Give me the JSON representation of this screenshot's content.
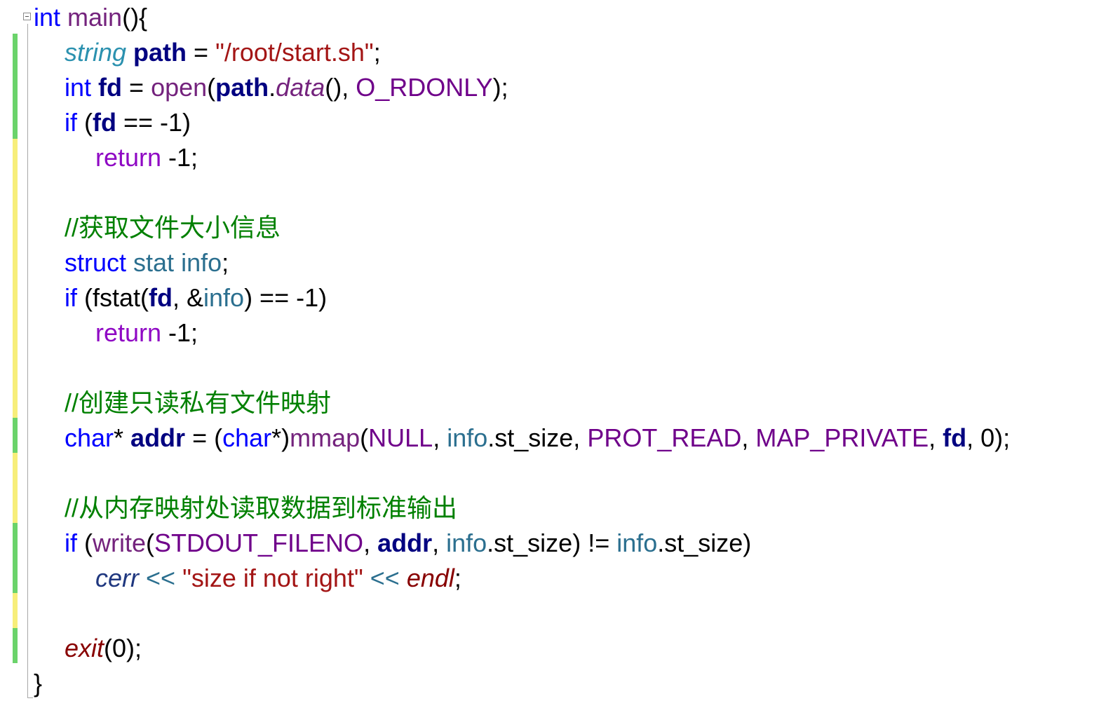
{
  "editor": {
    "colors": {
      "keyword": "#0000ff",
      "type": "#2b91af",
      "variable": "#000080",
      "string": "#a31515",
      "function": "#74237d",
      "macro": "#6f008a",
      "control": "#8f08c4",
      "comment": "#008000",
      "gutter_saved": "#6bd36b",
      "gutter_unsaved": "#f7ee7a"
    },
    "fold_icon": "collapse-minus-icon",
    "lines": [
      {
        "tokens": [
          [
            "kw",
            "int"
          ],
          [
            "plain",
            " "
          ],
          [
            "fn",
            "main"
          ],
          [
            "plain",
            "(){"
          ]
        ]
      },
      {
        "tokens": [
          [
            "ty",
            "string"
          ],
          [
            "plain",
            " "
          ],
          [
            "var",
            "path"
          ],
          [
            "plain",
            " = "
          ],
          [
            "str",
            "\"/root/start.sh\""
          ],
          [
            "plain",
            ";"
          ]
        ]
      },
      {
        "tokens": [
          [
            "kw",
            "int"
          ],
          [
            "plain",
            " "
          ],
          [
            "var",
            "fd"
          ],
          [
            "plain",
            " = "
          ],
          [
            "fn",
            "open"
          ],
          [
            "plain",
            "("
          ],
          [
            "var",
            "path"
          ],
          [
            "plain",
            "."
          ],
          [
            "fn ital",
            "data"
          ],
          [
            "plain",
            "(), "
          ],
          [
            "macro",
            "O_RDONLY"
          ],
          [
            "plain",
            ");"
          ]
        ]
      },
      {
        "tokens": [
          [
            "kw",
            "if"
          ],
          [
            "plain",
            " ("
          ],
          [
            "var",
            "fd"
          ],
          [
            "plain",
            " == -1)"
          ]
        ]
      },
      {
        "tokens": [
          [
            "ctl",
            "return"
          ],
          [
            "plain",
            " -1;"
          ]
        ]
      },
      {
        "tokens": []
      },
      {
        "tokens": [
          [
            "cm",
            "//获取文件大小信息"
          ]
        ]
      },
      {
        "tokens": [
          [
            "kw",
            "struct"
          ],
          [
            "plain",
            " "
          ],
          [
            "mem",
            "stat"
          ],
          [
            "plain",
            " "
          ],
          [
            "mem",
            "info"
          ],
          [
            "plain",
            ";"
          ]
        ]
      },
      {
        "tokens": [
          [
            "kw",
            "if"
          ],
          [
            "plain",
            " (fstat("
          ],
          [
            "var",
            "fd"
          ],
          [
            "plain",
            ", &"
          ],
          [
            "mem",
            "info"
          ],
          [
            "plain",
            ") == -1)"
          ]
        ]
      },
      {
        "tokens": [
          [
            "ctl",
            "return"
          ],
          [
            "plain",
            " -1;"
          ]
        ]
      },
      {
        "tokens": []
      },
      {
        "tokens": [
          [
            "cm",
            "//创建只读私有文件映射"
          ]
        ]
      },
      {
        "tokens": [
          [
            "kw",
            "char"
          ],
          [
            "plain",
            "* "
          ],
          [
            "var",
            "addr"
          ],
          [
            "plain",
            " = ("
          ],
          [
            "kw",
            "char"
          ],
          [
            "plain",
            "*)"
          ],
          [
            "fn",
            "mmap"
          ],
          [
            "plain",
            "("
          ],
          [
            "macro",
            "NULL"
          ],
          [
            "plain",
            ", "
          ],
          [
            "mem",
            "info"
          ],
          [
            "plain",
            ".st_size, "
          ],
          [
            "macro",
            "PROT_READ"
          ],
          [
            "plain",
            ", "
          ],
          [
            "macro",
            "MAP_PRIVATE"
          ],
          [
            "plain",
            ", "
          ],
          [
            "var",
            "fd"
          ],
          [
            "plain",
            ", 0);"
          ]
        ]
      },
      {
        "tokens": []
      },
      {
        "tokens": [
          [
            "cm",
            "//从内存映射处读取数据到标准输出"
          ]
        ]
      },
      {
        "tokens": [
          [
            "kw",
            "if"
          ],
          [
            "plain",
            " ("
          ],
          [
            "fn",
            "write"
          ],
          [
            "plain",
            "("
          ],
          [
            "macro",
            "STDOUT_FILENO"
          ],
          [
            "plain",
            ", "
          ],
          [
            "var",
            "addr"
          ],
          [
            "plain",
            ", "
          ],
          [
            "mem",
            "info"
          ],
          [
            "plain",
            ".st_size) != "
          ],
          [
            "mem",
            "info"
          ],
          [
            "plain",
            ".st_size)"
          ]
        ]
      },
      {
        "tokens": [
          [
            "local ital",
            "cerr"
          ],
          [
            "plain",
            " "
          ],
          [
            "mem",
            "<<"
          ],
          [
            "plain",
            " "
          ],
          [
            "str",
            "\"size if not right\""
          ],
          [
            "plain",
            " "
          ],
          [
            "mem",
            "<<"
          ],
          [
            "plain",
            " "
          ],
          [
            "ext",
            "endl"
          ],
          [
            "plain",
            ";"
          ]
        ]
      },
      {
        "tokens": []
      },
      {
        "tokens": [
          [
            "ext",
            "exit"
          ],
          [
            "plain",
            "(0);"
          ]
        ]
      },
      {
        "tokens": [
          [
            "plain",
            "}"
          ]
        ]
      }
    ]
  }
}
